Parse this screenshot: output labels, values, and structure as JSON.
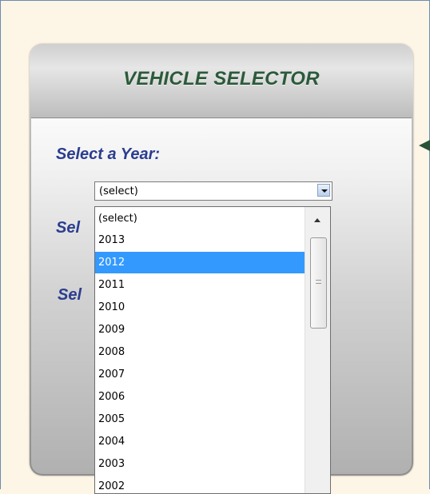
{
  "panel": {
    "title": "VEHICLE SELECTOR",
    "labels": {
      "year": "Select a Year:",
      "second_partial": "Sel",
      "third_partial": "Sel"
    }
  },
  "year_select": {
    "value": "(select)",
    "options": [
      "(select)",
      "2013",
      "2012",
      "2011",
      "2010",
      "2009",
      "2008",
      "2007",
      "2006",
      "2005",
      "2004",
      "2003",
      "2002"
    ],
    "highlighted": "2012"
  },
  "colors": {
    "title": "#2c5a3a",
    "label": "#2b3d8f",
    "highlight": "#3399ff",
    "page_bg": "#fdf5e6"
  },
  "icons": {
    "dropdown": "chevron-down-icon",
    "scroll_up": "scroll-up-arrow-icon",
    "pointer": "left-pointer-arrow-icon"
  }
}
